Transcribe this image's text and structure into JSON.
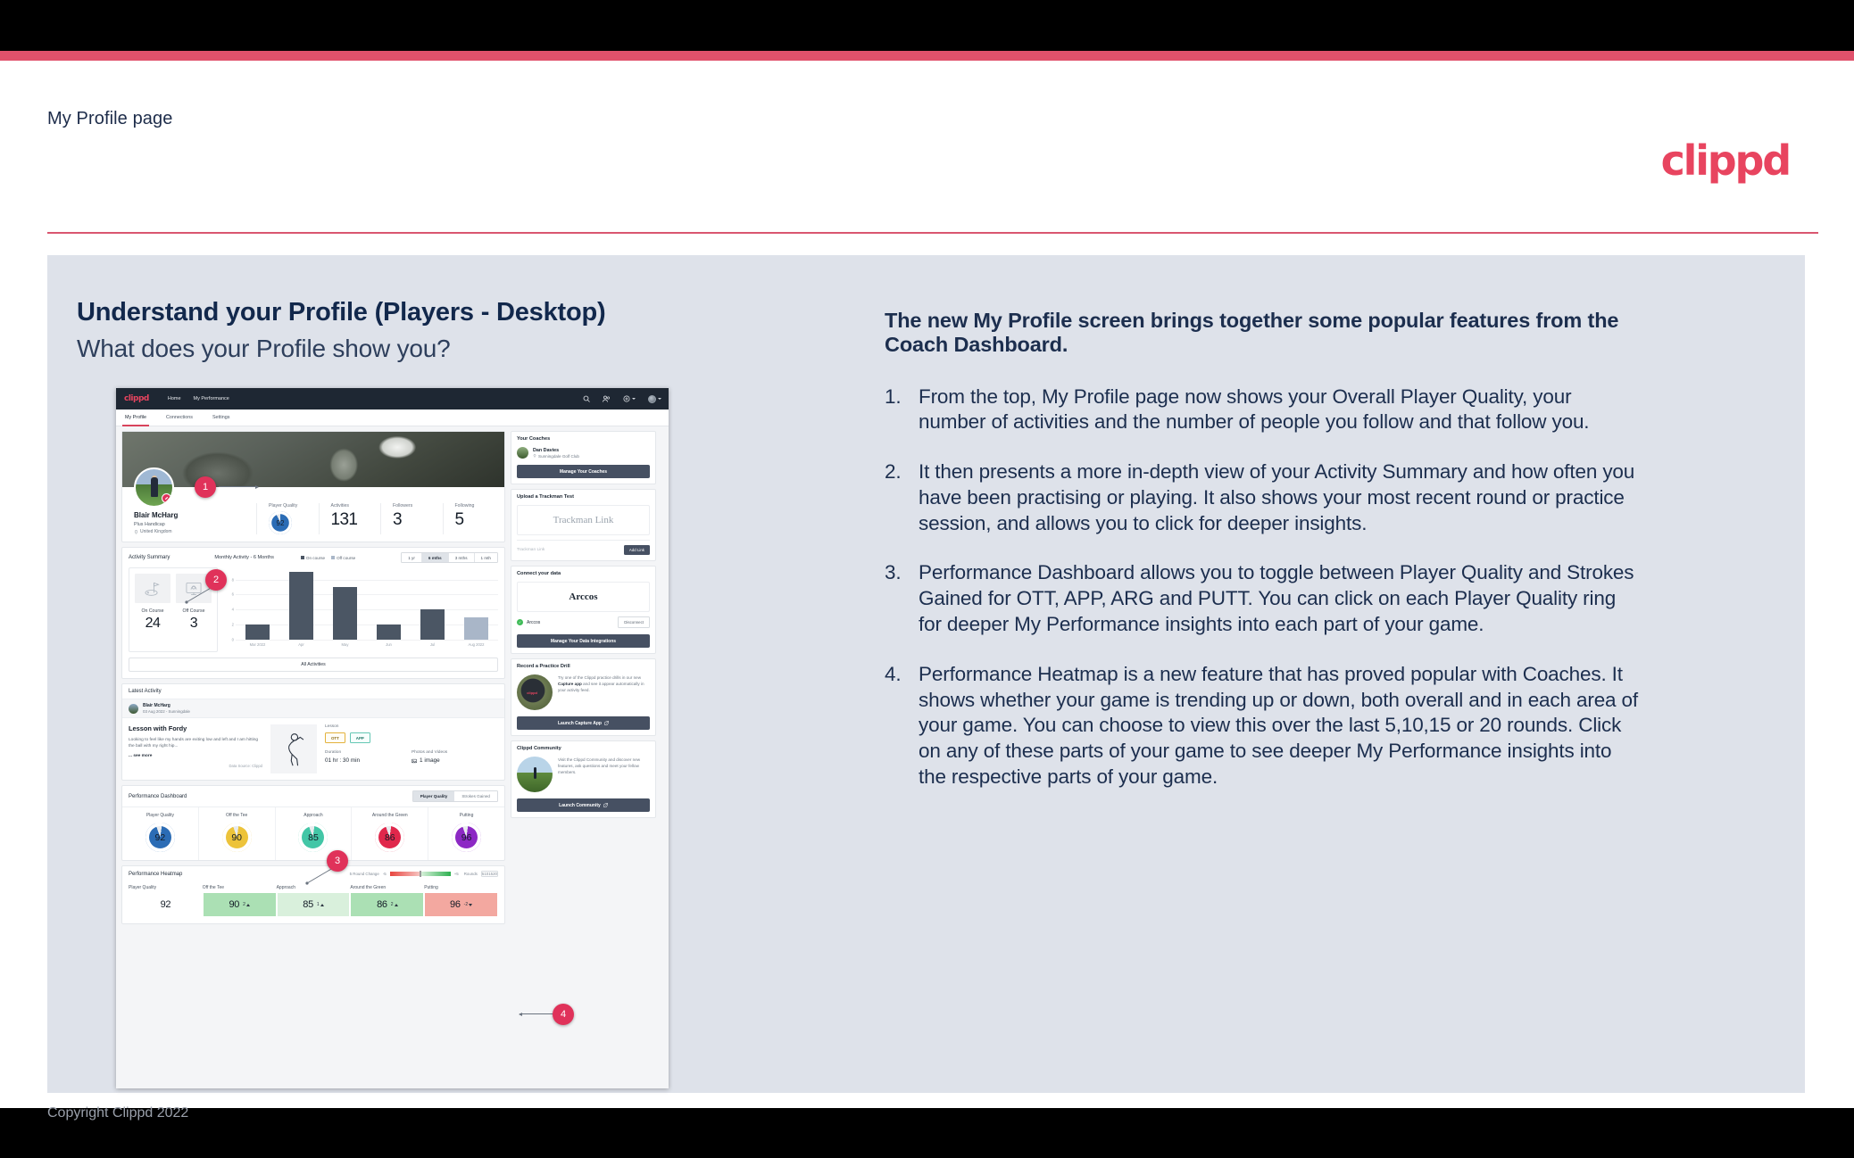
{
  "slide": {
    "header_label": "My Profile page",
    "brand": "clippd",
    "title": "Understand your Profile (Players - Desktop)",
    "subtitle": "What does your Profile show you?",
    "copyright": "Copyright Clippd 2022",
    "accent_color": "#e0516b",
    "panel_bg": "#dee2ea"
  },
  "explainer": {
    "lead": "The new My Profile screen brings together some popular features from the Coach Dashboard.",
    "items": [
      {
        "num": "1.",
        "text": "From the top, My Profile page now shows your Overall Player Quality, your number of activities and the number of people you follow and that follow you."
      },
      {
        "num": "2.",
        "text": "It then presents a more in-depth view of your Activity Summary and how often you have been practising or playing. It also shows your most recent round or practice session, and allows you to click for deeper insights."
      },
      {
        "num": "3.",
        "text": "Performance Dashboard allows you to toggle between Player Quality and Strokes Gained for OTT, APP, ARG and PUTT. You can click on each Player Quality ring for deeper My Performance insights into each part of your game."
      },
      {
        "num": "4.",
        "text": "Performance Heatmap is a new feature that has proved popular with Coaches. It shows whether your game is trending up or down, both overall and in each area of your game. You can choose to view this over the last 5,10,15 or 20 rounds. Click on any of these parts of your game to see deeper My Performance insights into the respective parts of your game."
      }
    ]
  },
  "callouts": [
    {
      "id": "1",
      "label": "1"
    },
    {
      "id": "2",
      "label": "2"
    },
    {
      "id": "3",
      "label": "3"
    },
    {
      "id": "4",
      "label": "4"
    }
  ],
  "app": {
    "navbar": {
      "logo": "clippd",
      "links": [
        "Home",
        "My Performance"
      ],
      "icons": [
        "search-icon",
        "people-icon",
        "plus-circle-icon",
        "avatar"
      ]
    },
    "tabs": [
      {
        "label": "My Profile",
        "active": true
      },
      {
        "label": "Connections",
        "active": false
      },
      {
        "label": "Settings",
        "active": false
      }
    ],
    "profile": {
      "name": "Blair McHarg",
      "handicap": "Plus Handicap",
      "location": "United Kingdom",
      "player_quality_label": "Player Quality",
      "player_quality": "92",
      "stats": [
        {
          "label": "Activities",
          "value": "131"
        },
        {
          "label": "Followers",
          "value": "3"
        },
        {
          "label": "Following",
          "value": "5"
        }
      ]
    },
    "activity_summary": {
      "title": "Activity Summary",
      "chart_title": "Monthly Activity - 6 Months",
      "legend": [
        {
          "label": "On course",
          "color": "#4b5664"
        },
        {
          "label": "Off course",
          "color": "#a9b6c8"
        }
      ],
      "ranges": [
        {
          "label": "1 yr",
          "active": false
        },
        {
          "label": "6 mths",
          "active": true
        },
        {
          "label": "3 mths",
          "active": false
        },
        {
          "label": "1 mth",
          "active": false
        }
      ],
      "tiles": [
        {
          "label": "On Course",
          "value": "24",
          "icon": "golf-flag-icon"
        },
        {
          "label": "Off Course",
          "value": "3",
          "icon": "monitor-icon"
        }
      ],
      "all_activities_label": "All Activities"
    },
    "latest_activity": {
      "title": "Latest Activity",
      "user": "Blair McHarg",
      "meta": "03 Aug 2022 - Sunningdale",
      "headline": "Lesson with Fordy",
      "body": "Looking to feel like my hands are exiting low and left and I am hitting the ball with my right hip...",
      "see_more": "... see more",
      "data_source": "Data Source: Clippd",
      "type_label": "Lesson",
      "chips": [
        "OTT",
        "APP"
      ],
      "duration_label": "Duration",
      "duration_value": "01 hr : 30 min",
      "media_label": "Photos and Videos",
      "media_value": "1 image"
    },
    "performance_dashboard": {
      "title": "Performance Dashboard",
      "toggle": [
        {
          "label": "Player Quality",
          "active": true
        },
        {
          "label": "Strokes Gained",
          "active": false
        }
      ],
      "rings": [
        {
          "label": "Player Quality",
          "value": "92",
          "color": "#2b6cb5"
        },
        {
          "label": "Off the Tee",
          "value": "90",
          "color": "#edc33a"
        },
        {
          "label": "Approach",
          "value": "85",
          "color": "#42c6a6"
        },
        {
          "label": "Around the Green",
          "value": "86",
          "color": "#e0274b"
        },
        {
          "label": "Putting",
          "value": "96",
          "color": "#8c28c4"
        }
      ]
    },
    "performance_heatmap": {
      "title": "Performance Heatmap",
      "change_label": "5 Round Change",
      "scale_min": "-5",
      "scale_max": "+5",
      "rounds_label": "Rounds",
      "rounds": [
        {
          "label": "5",
          "active": true
        },
        {
          "label": "10",
          "active": false
        },
        {
          "label": "15",
          "active": false
        },
        {
          "label": "20",
          "active": false
        }
      ],
      "cells": [
        {
          "label": "Player Quality",
          "value": "92",
          "delta": "",
          "dir": "none",
          "bg": "#ffffff"
        },
        {
          "label": "Off the Tee",
          "value": "90",
          "delta": "2",
          "dir": "up",
          "bg": "#abe0b4"
        },
        {
          "label": "Approach",
          "value": "85",
          "delta": "1",
          "dir": "up",
          "bg": "#d9f0dc"
        },
        {
          "label": "Around the Green",
          "value": "86",
          "delta": "2",
          "dir": "up",
          "bg": "#abe0b4"
        },
        {
          "label": "Putting",
          "value": "96",
          "delta": "-2",
          "dir": "down",
          "bg": "#f3a8a0"
        }
      ]
    },
    "sidebar": {
      "coaches": {
        "title": "Your Coaches",
        "coach_name": "Dan Davies",
        "coach_club": "Sunningdale Golf Club",
        "button": "Manage Your Coaches"
      },
      "trackman": {
        "title": "Upload a Trackman Test",
        "mock_text": "Trackman Link",
        "input_placeholder": "Trackman Link",
        "button": "Add Link"
      },
      "connect": {
        "title": "Connect your data",
        "mock_text": "Arccos",
        "source_name": "Arccos",
        "disconnect": "Disconnect",
        "button": "Manage Your Data Integrations"
      },
      "drill": {
        "title": "Record a Practice Drill",
        "body_1": "Try one of the Clippd practice drills in our new ",
        "body_bold": "Capture app",
        "body_2": " and see it appear automatically in your activity feed.",
        "button": "Launch Capture App"
      },
      "community": {
        "title": "Clippd Community",
        "body": "Visit the Clippd Community and discover new features, ask questions and meet your fellow members.",
        "button": "Launch Community"
      }
    }
  },
  "chart_data": {
    "type": "bar",
    "title": "Monthly Activity - 6 Months",
    "categories": [
      "Mar 2022",
      "Apr",
      "May",
      "Jun",
      "Jul",
      "Aug 2022"
    ],
    "series": [
      {
        "name": "On course",
        "color": "#4b5664",
        "values": [
          2,
          9,
          7,
          2,
          4,
          0
        ]
      },
      {
        "name": "Off course",
        "color": "#a9b6c8",
        "values": [
          0,
          0,
          0,
          0,
          0,
          3
        ]
      }
    ],
    "yticks": [
      0,
      2,
      4,
      6,
      8
    ],
    "ylim": [
      0,
      9.6
    ],
    "xlabel": "",
    "ylabel": "",
    "grid": true,
    "legend_position": "top"
  }
}
